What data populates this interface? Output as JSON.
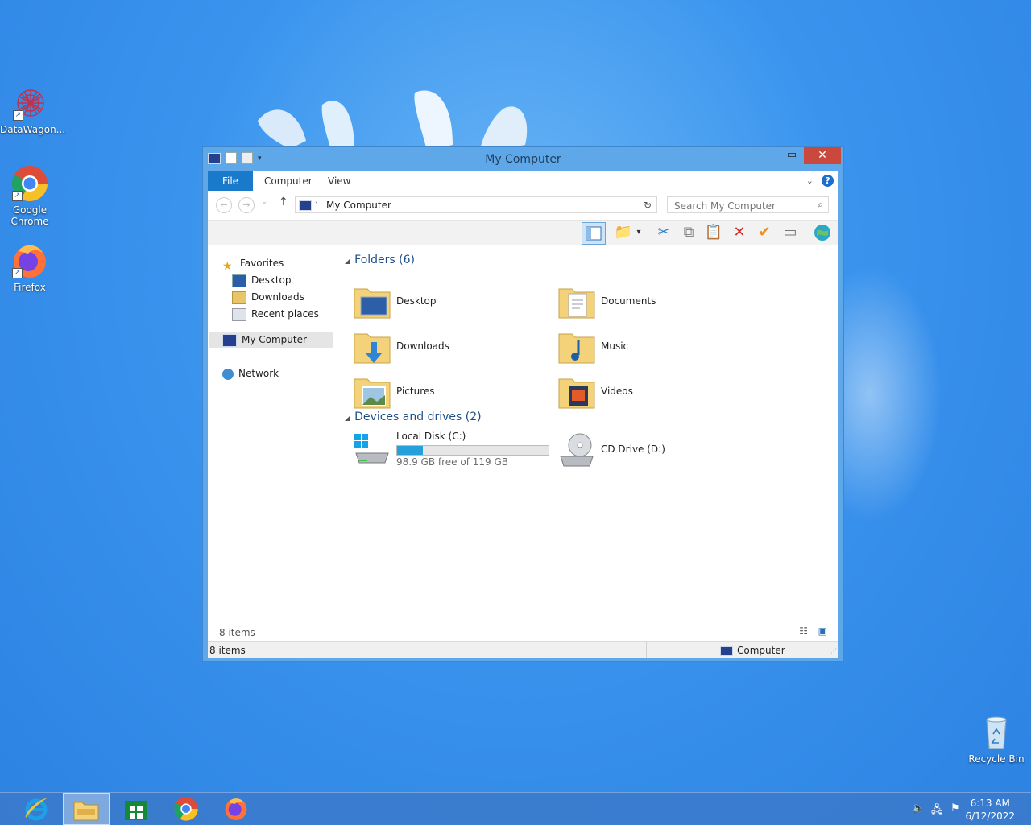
{
  "desktop": {
    "icons": [
      {
        "label": "DataWagon..."
      },
      {
        "label": "Google Chrome"
      },
      {
        "label": "Firefox"
      },
      {
        "label": "Recycle Bin"
      }
    ]
  },
  "window": {
    "title": "My Computer",
    "ribbon": {
      "tabs": [
        {
          "label": "File"
        },
        {
          "label": "Computer"
        },
        {
          "label": "View"
        }
      ]
    },
    "address": {
      "path": "My Computer",
      "search_placeholder": "Search My Computer"
    },
    "nav": {
      "favorites": "Favorites",
      "favorite_items": [
        {
          "label": "Desktop"
        },
        {
          "label": "Downloads"
        },
        {
          "label": "Recent places"
        }
      ],
      "computer": "My Computer",
      "network": "Network"
    },
    "content": {
      "folders_header": "Folders (6)",
      "folders": [
        {
          "label": "Desktop"
        },
        {
          "label": "Documents"
        },
        {
          "label": "Downloads"
        },
        {
          "label": "Music"
        },
        {
          "label": "Pictures"
        },
        {
          "label": "Videos"
        }
      ],
      "drives_header": "Devices and drives (2)",
      "drives": [
        {
          "label": "Local Disk (C:)",
          "free_text": "98.9 GB free of 119 GB",
          "used_fraction": 0.17
        },
        {
          "label": "CD Drive (D:)"
        }
      ]
    },
    "status_count": "8 items",
    "statusbar": {
      "left": "8 items",
      "right": "Computer"
    }
  },
  "taskbar": {
    "time": "6:13 AM",
    "date": "6/12/2022"
  },
  "colors": {
    "accent": "#1979ca",
    "drive_fill": "#26a0da",
    "close_button": "#c94a3c"
  }
}
